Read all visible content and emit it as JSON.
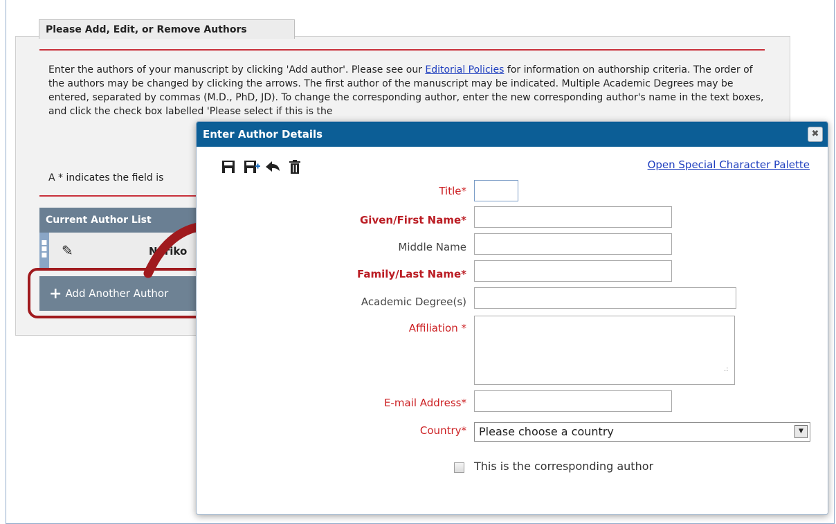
{
  "panel": {
    "tab_title": "Please Add, Edit, or Remove Authors",
    "intro_before_link": "Enter the authors of your manuscript by clicking 'Add author'. Please see our ",
    "intro_link": "Editorial Policies",
    "intro_after_link": " for information on authorship criteria. The order of the authors may be changed by clicking the arrows. The first author of the manuscript may be indicated. Multiple Academic Degrees may be entered, separated by commas (M.D., PhD, JD). To change the corresponding author, enter the new corresponding author's name in the text boxes, and click the check box labelled 'Please select if this is the",
    "required_note": "A * indicates the field is"
  },
  "author_list": {
    "header": "Current Author List",
    "rows": [
      {
        "name": "Noriko"
      }
    ],
    "add_button_label": "Add Another Author"
  },
  "dialog": {
    "title": "Enter Author Details",
    "close_glyph": "✖",
    "palette_link": "Open Special Character Palette",
    "toolbar": [
      {
        "name": "save-icon",
        "glyph": "💾"
      },
      {
        "name": "save-and-add-icon",
        "glyph": "💾+"
      },
      {
        "name": "back-arrow-icon",
        "glyph": "⬅"
      },
      {
        "name": "trash-icon",
        "glyph": "🗑"
      }
    ],
    "fields": {
      "title": {
        "label": "Title*",
        "value": ""
      },
      "given_name": {
        "label": "Given/First Name*",
        "value": ""
      },
      "middle_name": {
        "label": "Middle Name",
        "value": ""
      },
      "family_name": {
        "label": "Family/Last Name*",
        "value": ""
      },
      "academic_degrees": {
        "label": "Academic Degree(s)",
        "value": ""
      },
      "affiliation": {
        "label": "Affiliation *",
        "value": ""
      },
      "email": {
        "label": "E-mail Address*",
        "value": ""
      },
      "country": {
        "label": "Country*",
        "selected": "Please choose a country"
      }
    },
    "corresponding_checkbox_label": "This is the corresponding author",
    "corresponding_checked": false
  },
  "colors": {
    "accent_red": "#c8303a",
    "dialog_header": "#0c5e96",
    "list_header": "#6a7f93",
    "highlight": "#a01a1e",
    "link": "#1f3fbf"
  }
}
